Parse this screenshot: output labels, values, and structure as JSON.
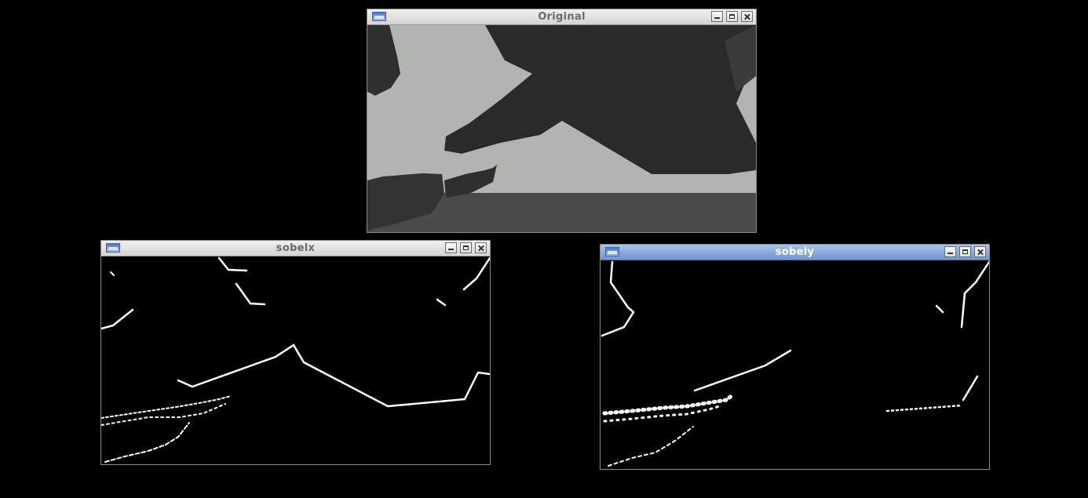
{
  "windows": {
    "original": {
      "title": "Original"
    },
    "sobelx": {
      "title": "sobelx"
    },
    "sobely": {
      "title": "sobely"
    }
  },
  "colors": {
    "desktop": "#000000",
    "sky": "#b1b5b0",
    "ground": "#4b4b4b",
    "object": "#2a2a2a",
    "edge": "#ffffff",
    "active_titlebar": "#7f9fd8",
    "inactive_titlebar": "#e3e2de"
  },
  "icons": [
    "window-icon",
    "minimize-icon",
    "maximize-icon",
    "close-icon"
  ]
}
